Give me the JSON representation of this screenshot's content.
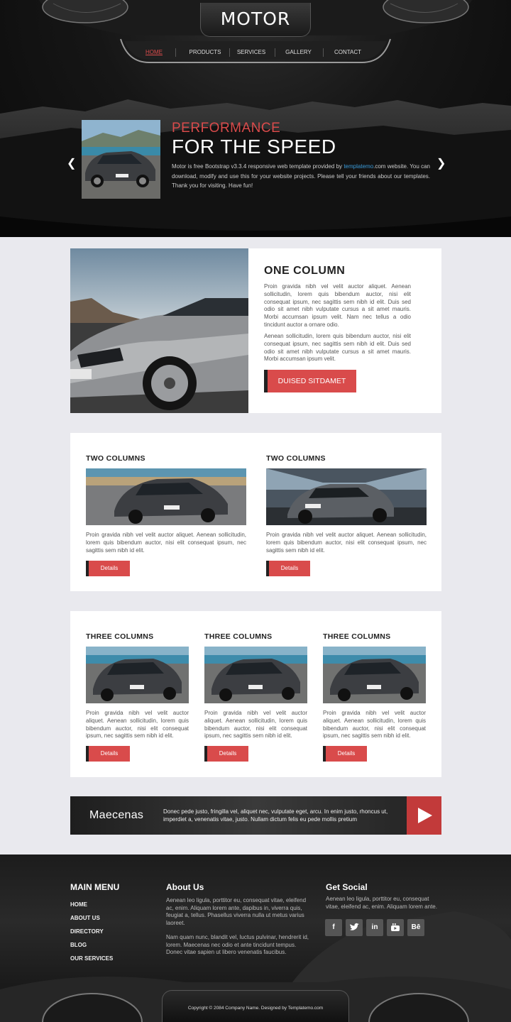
{
  "header": {
    "logo": "MOTOR",
    "nav": [
      {
        "label": "HOME",
        "active": true
      },
      {
        "label": "PRODUCTS",
        "active": false
      },
      {
        "label": "SERVICES",
        "active": false
      },
      {
        "label": "GALLERY",
        "active": false
      },
      {
        "label": "CONTACT",
        "active": false
      }
    ]
  },
  "slider": {
    "kicker": "PERFORMANCE",
    "title": "FOR THE SPEED",
    "text_before_link": "Motor is free Bootstrap v3.3.4 responsive web template provided by ",
    "link": "templatemo",
    "text_after_link": ".com website. You can download, modify and use this for your website projects. Please tell your friends about our templates. Thank you for visiting. Have fun!",
    "prev_icon": "chevron-left-icon",
    "next_icon": "chevron-right-icon"
  },
  "one_column": {
    "title": "ONE COLUMN",
    "paragraph1": "Proin gravida nibh vel velit auctor aliquet. Aenean sollicitudin, lorem quis bibendum auctor, nisi elit consequat ipsum, nec sagittis sem nibh id elit. Duis sed odio sit amet nibh vulputate cursus a sit amet mauris. Morbi accumsan ipsum velit. Nam nec tellus a odio tincidunt auctor a ornare odio.",
    "paragraph2": "Aenean sollicitudin, lorem quis bibendum auctor, nisi elit consequat ipsum, nec sagittis sem nibh id elit. Duis sed odio sit amet nibh vulputate cursus a sit amet mauris. Morbi accumsan ipsum velit.",
    "button": "DUISED SITDAMET"
  },
  "two_columns": [
    {
      "title": "TWO COLUMNS",
      "text": "Proin gravida nibh vel velit auctor aliquet. Aenean sollicitudin, lorem quis bibendum auctor, nisi elit consequat ipsum, nec sagittis sem nibh id elit.",
      "button": "Details"
    },
    {
      "title": "TWO COLUMNS",
      "text": "Proin gravida nibh vel velit auctor aliquet. Aenean sollicitudin, lorem quis bibendum auctor, nisi elit consequat ipsum, nec sagittis sem nibh id elit.",
      "button": "Details"
    }
  ],
  "three_columns": [
    {
      "title": "THREE COLUMNS",
      "text": "Proin gravida nibh vel velit auctor aliquet. Aenean sollicitudin, lorem quis bibendum auctor, nisi elit consequat ipsum, nec sagittis sem nibh id elit.",
      "button": "Details"
    },
    {
      "title": "THREE COLUMNS",
      "text": "Proin gravida nibh vel velit auctor aliquet. Aenean sollicitudin, lorem quis bibendum auctor, nisi elit consequat ipsum, nec sagittis sem nibh id elit.",
      "button": "Details"
    },
    {
      "title": "THREE COLUMNS",
      "text": "Proin gravida nibh vel velit auctor aliquet. Aenean sollicitudin, lorem quis bibendum auctor, nisi elit consequat ipsum, nec sagittis sem nibh id elit.",
      "button": "Details"
    }
  ],
  "banner": {
    "title": "Maecenas",
    "text": "Donec pede justo, fringilla vel, aliquet nec, vulputate eget, arcu. In enim justo, rhoncus ut, imperdiet a, venenatis vitae, justo. Nullam dictum felis eu pede mollis pretium",
    "play_icon": "play-icon"
  },
  "footer": {
    "main_menu_title": "MAIN MENU",
    "main_menu": [
      "HOME",
      "ABOUT US",
      "DIRECTORY",
      "BLOG",
      "OUR SERVICES"
    ],
    "about_title": "About Us",
    "about_p1": "Aenean leo ligula, porttitor eu, consequat vitae, eleifend ac, enim. Aliquam lorem ante, dapibus in, viverra quis, feugiat a, tellus. Phasellus viverra nulla ut metus varius laoreet.",
    "about_p2": "Nam quam nunc, blandit vel, luctus pulvinar, hendrerit id, lorem. Maecenas nec odio et ante tincidunt tempus. Donec vitae sapien ut libero venenatis faucibus.",
    "social_title": "Get Social",
    "social_text": "Aenean leo ligula, porttitor eu, consequat vitae, eleifend ac, enim. Aliquam lorem ante.",
    "social_icons": [
      {
        "name": "facebook-icon",
        "glyph": "f"
      },
      {
        "name": "twitter-icon",
        "glyph": "🐦"
      },
      {
        "name": "linkedin-icon",
        "glyph": "in"
      },
      {
        "name": "youtube-icon",
        "glyph": "▶"
      },
      {
        "name": "behance-icon",
        "glyph": "Bē"
      }
    ],
    "copyright": "Copyright © 2084 Company Name. Designed by Templatemo.com"
  },
  "colors": {
    "accent": "#d94b4b",
    "accent_dark": "#c23a3a",
    "link": "#3b9bd9",
    "page_bg": "#e9e9ee",
    "header_bg": "#111111"
  }
}
